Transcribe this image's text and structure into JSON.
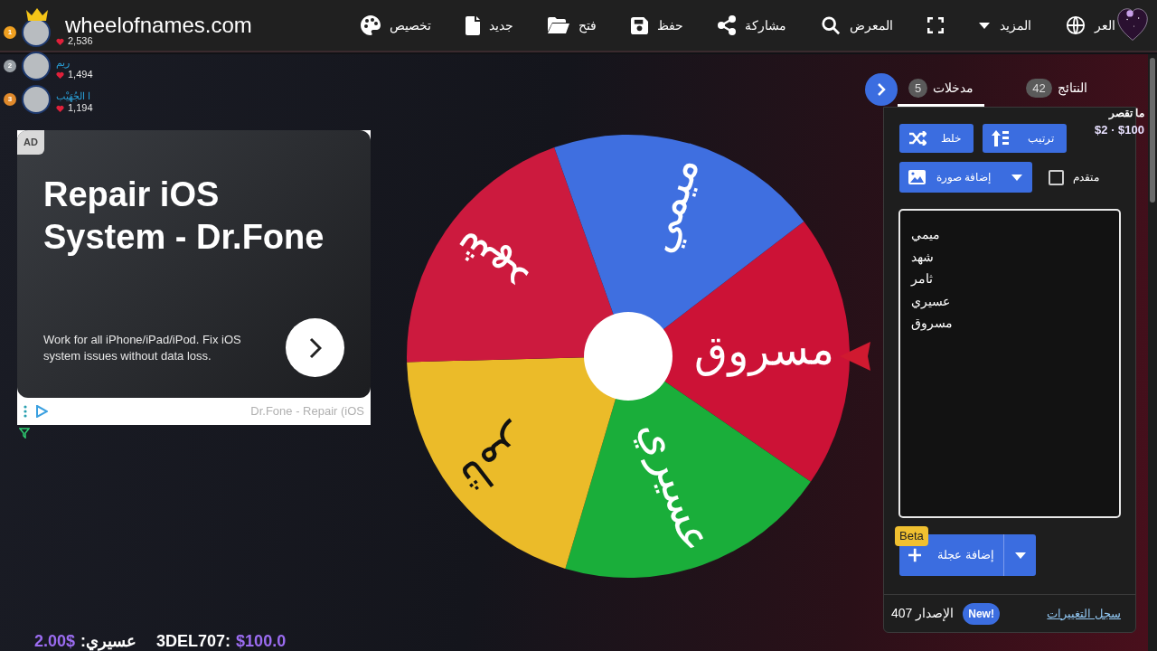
{
  "header": {
    "logo": "wheelofnames.com",
    "nav": [
      "العر",
      "المزيد",
      "المعرض",
      "مشاركة",
      "حفظ",
      "فتح",
      "جديد",
      "تخصيص"
    ]
  },
  "leaderboard": [
    {
      "rank": "1",
      "color": "#f0a020",
      "crowned": true,
      "likes": "2,536"
    },
    {
      "rank": "2",
      "color": "#9aa0a6",
      "crowned": false,
      "name": "ريم",
      "likes": "1,494"
    },
    {
      "rank": "3",
      "color": "#e0892b",
      "crowned": false,
      "name": "ا الجُهَيْب",
      "likes": "1,194"
    }
  ],
  "ad": {
    "badge": "AD",
    "title": "Repair iOS System - Dr.Fone",
    "description": "Work for all iPhone/iPad/iPod. Fix iOS system issues without data loss.",
    "source": "Dr.Fone - Repair (iOS"
  },
  "wheel": {
    "segments": [
      {
        "label": "مسروق",
        "color": "#cc1236"
      },
      {
        "label": "عسيري",
        "color": "#1aae3a"
      },
      {
        "label": "ثامر",
        "color": "#ebbb29"
      },
      {
        "label": "شهد",
        "color": "#cc1a3e"
      },
      {
        "label": "ميمي",
        "color": "#3f6fe0"
      }
    ]
  },
  "panel": {
    "tabs": [
      {
        "label": "النتائج",
        "count": "42",
        "selected": false
      },
      {
        "label": "مدخلات",
        "count": "5",
        "selected": true
      }
    ],
    "shuffle": "خلط",
    "sort": "ترتيب",
    "add_image": "إضافة صورة",
    "advanced": {
      "label": "متقدم",
      "checked": false
    },
    "entries": [
      "ميمي",
      "شهد",
      "ثامر",
      "عسيري",
      "مسروق"
    ],
    "add_wheel": "إضافة عجلة",
    "beta": "Beta",
    "version": "الإصدار 407",
    "new_badge": "New!",
    "changelog": "سجل التغييرات"
  },
  "goal": {
    "title": "ما تقصر",
    "range": "$2 · $100"
  },
  "ticker": [
    {
      "name": "3DEL707:",
      "amount": "$100.0"
    },
    {
      "name": "عسيري:",
      "amount": "2.00$"
    }
  ]
}
